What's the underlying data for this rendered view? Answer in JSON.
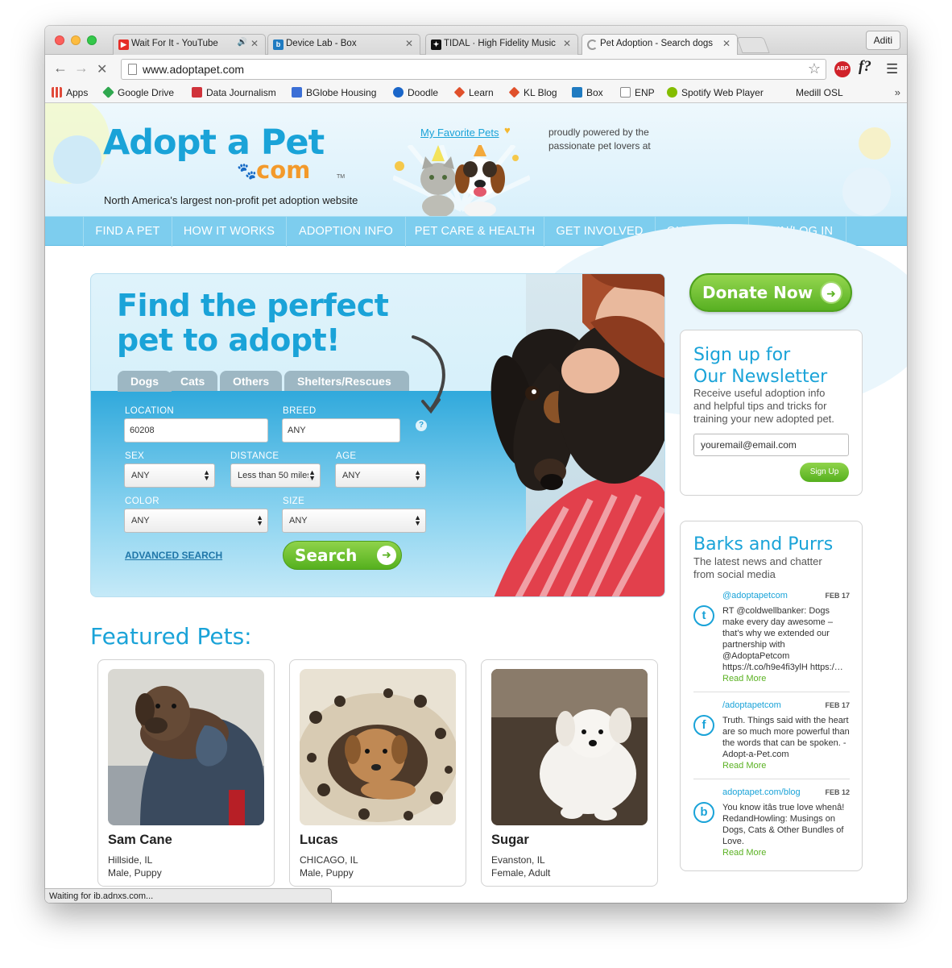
{
  "browser": {
    "tabs": [
      {
        "title": "Wait For It - YouTube",
        "favicon_color": "#e52d27"
      },
      {
        "title": "Device Lab - Box",
        "favicon_color": "#1f7bc1"
      },
      {
        "title": "TIDAL · High Fidelity Music",
        "favicon_color": "#111111"
      },
      {
        "title": "Pet Adoption - Search dogs",
        "favicon_color": "#c7c7c7"
      }
    ],
    "user_button": "Aditi",
    "url": "www.adoptapet.com",
    "abp_badge": "ABP",
    "ext_f_label": "f?",
    "bookmarks": [
      {
        "label": "Apps",
        "icon": "apps-grid-icon",
        "color": "#e04a3a"
      },
      {
        "label": "Google Drive",
        "icon": "google-drive-icon",
        "color": "#2fa84f"
      },
      {
        "label": "Data Journalism",
        "icon": "data-journalism-icon",
        "color": "#d0333b"
      },
      {
        "label": "BGlobe Housing",
        "icon": "docs-icon",
        "color": "#3b6fd6"
      },
      {
        "label": "Doodle",
        "icon": "doodle-icon",
        "color": "#1a66c9"
      },
      {
        "label": "Learn",
        "icon": "learn-icon",
        "color": "#e0502b"
      },
      {
        "label": "KL Blog",
        "icon": "kl-blog-icon",
        "color": "#e0502b"
      },
      {
        "label": "Box",
        "icon": "box-icon",
        "color": "#1f7bc1"
      },
      {
        "label": "ENP",
        "icon": "page-icon",
        "color": "#ffffff"
      },
      {
        "label": "Spotify Web Player",
        "icon": "spotify-icon",
        "color": "#84bd00"
      },
      {
        "label": "Medill OSL",
        "icon": "",
        "color": ""
      }
    ],
    "status_text": "Waiting for ib.adnxs.com..."
  },
  "site": {
    "logo_main": "Adopt a Pet",
    "logo_com": "com",
    "logo_tm": "TM",
    "tagline": "North America's largest non-profit pet adoption website",
    "favorite_pets_link": "My Favorite Pets",
    "powered_line1": "proudly powered by the",
    "powered_line2": "passionate pet lovers at",
    "nav": [
      "FIND A PET",
      "HOW IT WORKS",
      "ADOPTION INFO",
      "PET CARE & HEALTH",
      "GET INVOLVED",
      "OUR STORE",
      "JOIN/LOG IN"
    ]
  },
  "hero": {
    "title_line1": "Find the perfect",
    "title_line2": "pet to adopt!",
    "tabs": [
      "Dogs",
      "Cats",
      "Others",
      "Shelters/Rescues"
    ],
    "active_tab": "Dogs",
    "location_label": "LOCATION",
    "location_value": "60208",
    "breed_label": "BREED",
    "breed_value": "ANY",
    "help_mark": "?",
    "sex_label": "SEX",
    "sex_value": "ANY",
    "distance_label": "DISTANCE",
    "distance_value": "Less than 50 miles",
    "age_label": "AGE",
    "age_value": "ANY",
    "color_label": "COLOR",
    "color_value": "ANY",
    "size_label": "SIZE",
    "size_value": "ANY",
    "advanced_search": "ADVANCED SEARCH",
    "search_button": "Search"
  },
  "sidebar": {
    "donate": "Donate Now",
    "newsletter": {
      "title_line1": "Sign up for",
      "title_line2": "Our Newsletter",
      "subtitle_line1": "Receive useful adoption info",
      "subtitle_line2": "and helpful tips and tricks for",
      "subtitle_line3": "training your new adopted pet.",
      "email_value": "youremail@email.com",
      "signup_button": "Sign Up"
    },
    "barks": {
      "title": "Barks and Purrs",
      "subtitle_line1": "The latest news and chatter",
      "subtitle_line2": "from social media",
      "items": [
        {
          "source": "@adoptapetcom",
          "date": "FEB 17",
          "icon": "twitter-icon",
          "glyph": "t",
          "text": "RT @coldwellbanker: Dogs make every day awesome – that's why we extended our partnership with @AdoptaPetcom https://t.co/h9e4fi3ylH https:/…",
          "more": "Read More"
        },
        {
          "source": "/adoptapetcom",
          "date": "FEB 17",
          "icon": "facebook-icon",
          "glyph": "f",
          "text": "Truth. Things said with the heart are so much more powerful than the words that can be spoken. - Adopt-a-Pet.com",
          "more": "Read More"
        },
        {
          "source": "adoptapet.com/blog",
          "date": "FEB 12",
          "icon": "blog-icon",
          "glyph": "b",
          "text": "You know itâs true love whenâ! RedandHowling: Musings on Dogs, Cats & Other Bundles of Love.",
          "more": "Read More"
        }
      ]
    }
  },
  "featured": {
    "title": "Featured Pets:",
    "pets": [
      {
        "name": "Sam Cane",
        "location": "Hillside, IL",
        "meta": "Male, Puppy"
      },
      {
        "name": "Lucas",
        "location": "CHICAGO, IL",
        "meta": "Male, Puppy"
      },
      {
        "name": "Sugar",
        "location": "Evanston, IL",
        "meta": "Female, Adult"
      }
    ]
  },
  "colors": {
    "brand_blue": "#1aa3d8",
    "brand_orange": "#f39a2b",
    "nav_blue": "#7dcdee",
    "cta_green": "#5bb223"
  }
}
